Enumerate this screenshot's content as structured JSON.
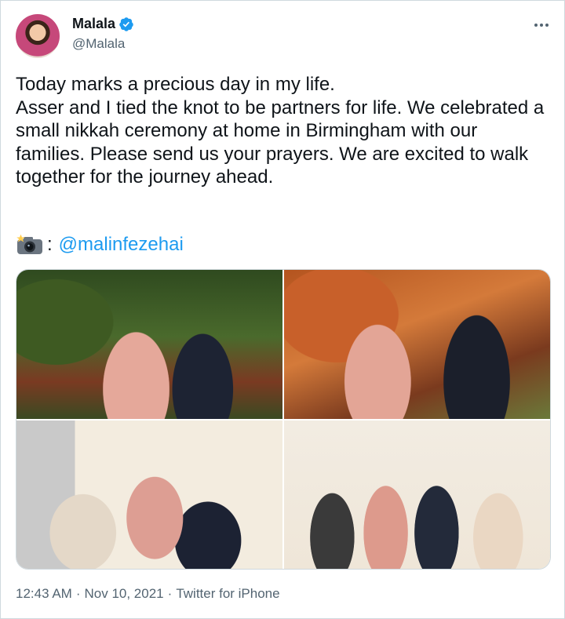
{
  "author": {
    "name": "Malala",
    "handle": "@Malala",
    "verified_icon": "verified-badge-icon",
    "accent": "#1d9bf0"
  },
  "tweet": {
    "text": "Today marks a precious day in my life.\nAsser and I tied the knot to be partners for life. We celebrated a small nikkah ceremony at home in Birmingham with our families. Please send us your prayers. We are excited to walk together for the journey ahead.",
    "credit_colon": ":",
    "credit_mention": "@malinfezehai"
  },
  "media": {
    "photos": [
      "garden-portrait-photo",
      "autumn-leaves-portrait-photo",
      "nikkah-signing-photo",
      "family-group-photo"
    ]
  },
  "meta": {
    "time": "12:43 AM",
    "separator1": "·",
    "date": "Nov 10, 2021",
    "separator2": "·",
    "source": "Twitter for iPhone"
  }
}
